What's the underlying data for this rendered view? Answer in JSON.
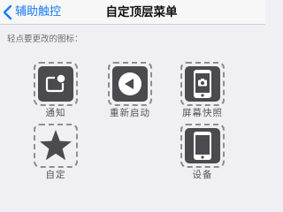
{
  "nav": {
    "back_label": "辅助触控",
    "title": "自定顶层菜单"
  },
  "hint": "轻点要更改的图标：",
  "icons": [
    {
      "label": "通知",
      "icon": "notification-icon"
    },
    {
      "label": "重新启动",
      "icon": "restart-icon"
    },
    {
      "label": "屏幕快照",
      "icon": "screenshot-icon"
    },
    {
      "label": "自定",
      "icon": "star-icon"
    },
    {
      "label": "设备",
      "icon": "device-icon"
    }
  ],
  "colors": {
    "accent": "#1a7cf6",
    "background": "#efeff4",
    "tile": "#4a4a4f",
    "dash": "#8d8d92"
  }
}
